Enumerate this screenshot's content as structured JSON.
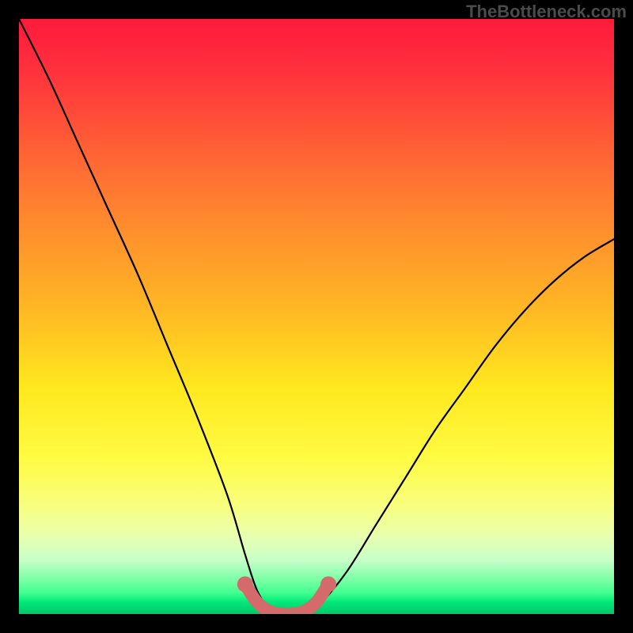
{
  "watermark": {
    "text": "TheBottleneck.com"
  },
  "colors": {
    "curve": "#000000",
    "marker_fill": "#d46a6a",
    "marker_stroke": "#c85a5a"
  },
  "chart_data": {
    "type": "line",
    "title": "",
    "xlabel": "",
    "ylabel": "",
    "xlim": [
      0,
      100
    ],
    "ylim": [
      0,
      100
    ],
    "grid": false,
    "legend": false,
    "series": [
      {
        "name": "bottleneck-curve",
        "x": [
          0,
          5,
          10,
          15,
          20,
          25,
          30,
          35,
          38,
          40,
          42,
          44,
          46,
          48,
          50,
          55,
          60,
          65,
          70,
          75,
          80,
          85,
          90,
          95,
          100
        ],
        "y": [
          100,
          90,
          79,
          68,
          57,
          45,
          33,
          20,
          10,
          4,
          1,
          0,
          0,
          0,
          1,
          7,
          15,
          23,
          31,
          38,
          45,
          51,
          56,
          60,
          63
        ]
      }
    ],
    "highlight": {
      "name": "optimal-range",
      "x": [
        38,
        40,
        42,
        44,
        46,
        48,
        50,
        52
      ],
      "y": [
        5,
        2,
        0.5,
        0,
        0,
        0.5,
        2,
        5
      ]
    }
  }
}
